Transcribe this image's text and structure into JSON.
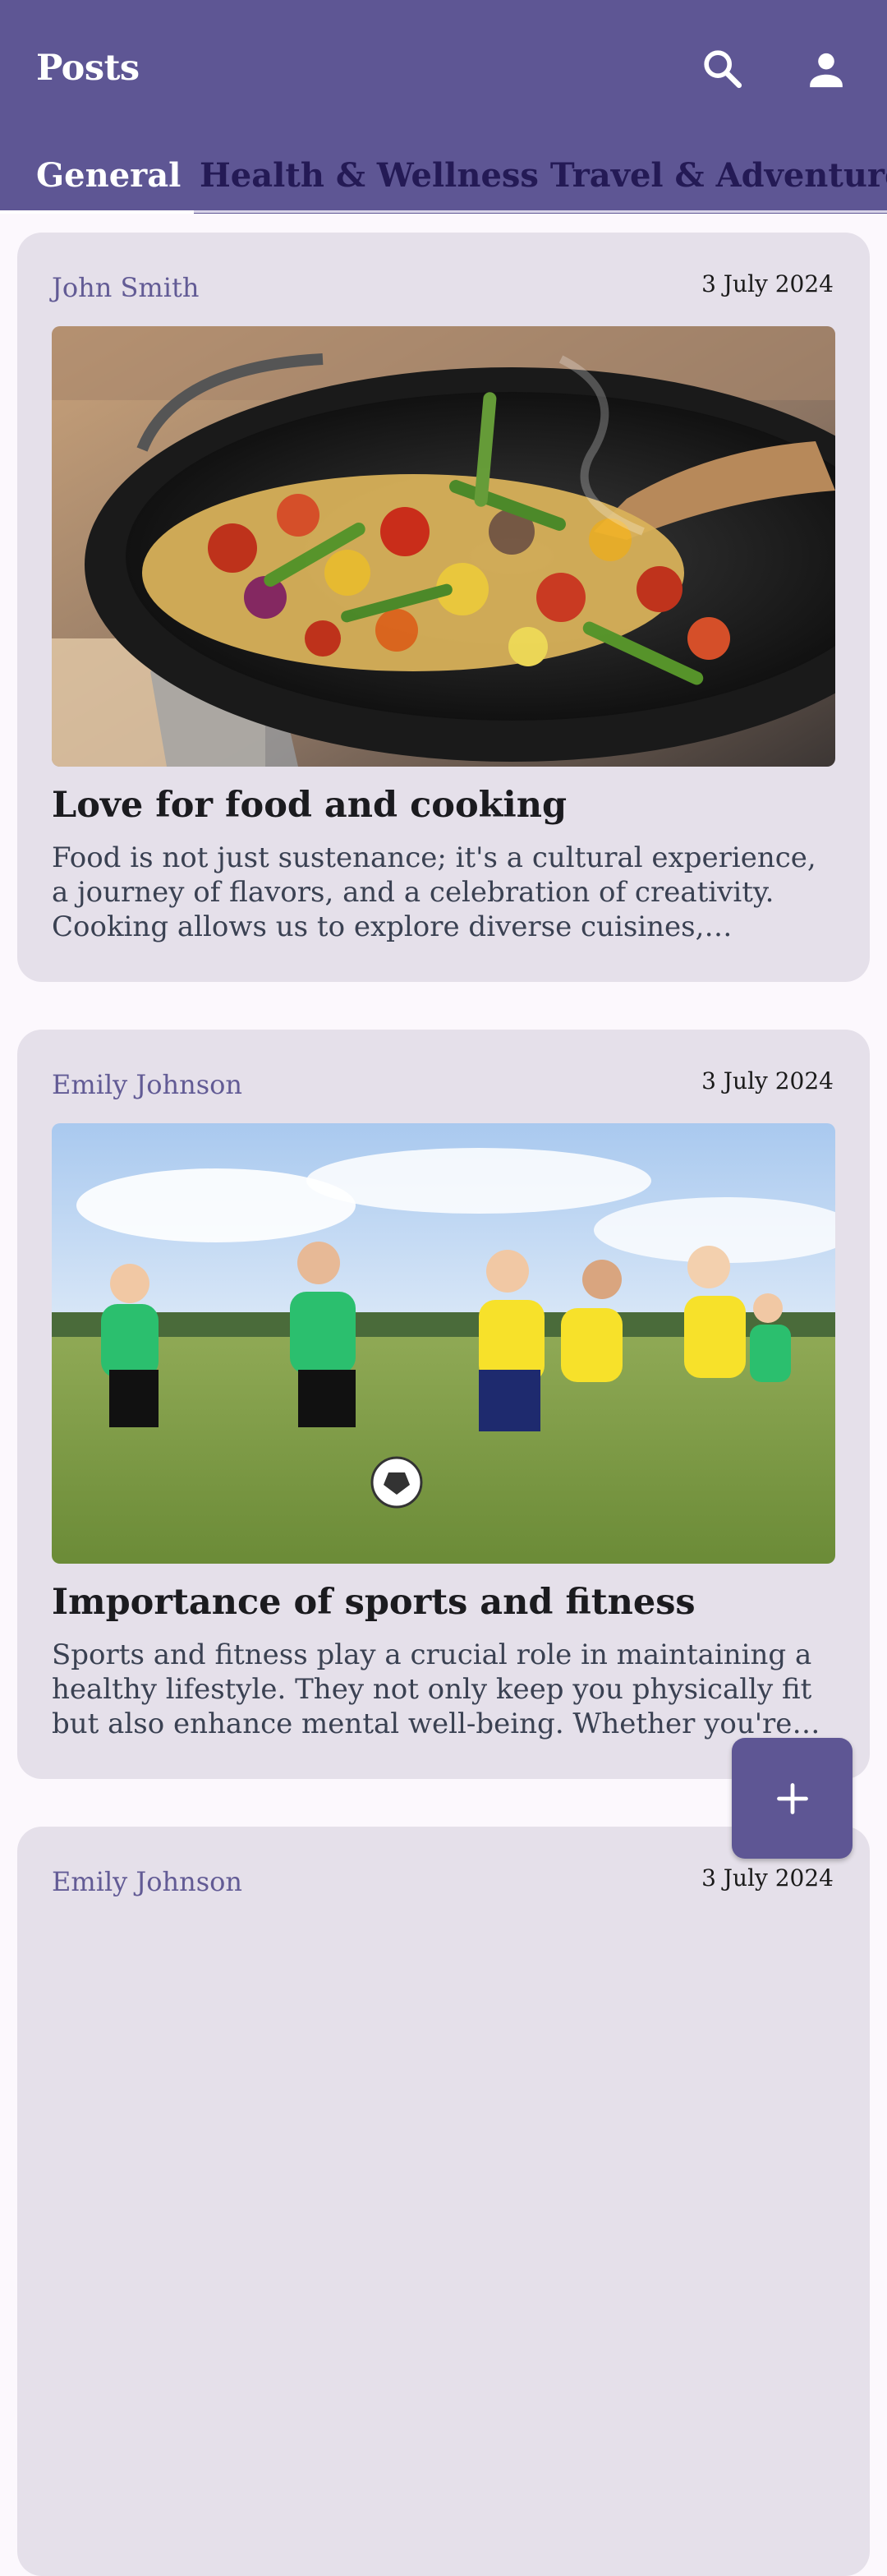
{
  "appbar": {
    "title": "Posts",
    "search_icon": "search-icon",
    "account_icon": "account-icon"
  },
  "tabs": [
    {
      "label": "General",
      "selected": true
    },
    {
      "label": "Health & Wellness Travel & Adventure Tech",
      "selected": false
    }
  ],
  "posts": [
    {
      "author": "John Smith",
      "date": "3 July 2024",
      "image": "wok of stir-fried vegetables",
      "title": "Love for food and cooking",
      "body": "Food is not just sustenance; it's a cultural experience, a journey of flavors, and a celebration of creativity. Cooking allows us to explore diverse cuisines, experiment with ingredients and share meals with the people we love."
    },
    {
      "author": "Emily Johnson",
      "date": "3 July 2024",
      "image": "children playing soccer on a field",
      "title": "Importance of sports and fitness",
      "body": "Sports and fitness play a crucial role in maintaining a healthy lifestyle. They not only keep you physically fit but also enhance mental well-being. Whether you're playing a team sport or working out alone, staying active matters."
    },
    {
      "author": "Emily Johnson",
      "date": "3 July 2024"
    }
  ],
  "fab": {
    "icon": "plus-icon"
  },
  "colors": {
    "primary": "#5e5694",
    "card_bg": "#e5e0ea",
    "author": "#625b95",
    "page_bg": "#fcf8fd"
  }
}
